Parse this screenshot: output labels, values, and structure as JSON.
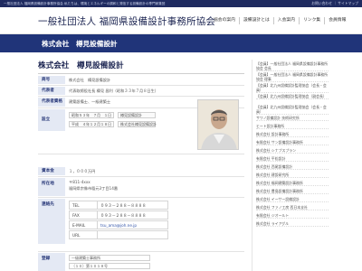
{
  "topbar": {
    "tagline": "一般社団法人 福岡県設備設計事務所協会 私たちは、環境とエネルギーの調和と発信する設備設計の専門家集団",
    "util_links": "お問い合わせ ｜ サイトマップ"
  },
  "header": {
    "site_title": "一般社団法人 福岡県設備設計事務所協会",
    "nav": [
      "協会の案内",
      "設備設計とは",
      "入会案内",
      "リンク集",
      "会員情報"
    ]
  },
  "band": {
    "title": "株式会社　樽見設備設計"
  },
  "main": {
    "company_name": "株式会社　樽見設備設計",
    "rows": {
      "name_label": "商号",
      "name_value": "株式会社　樽見設備設計",
      "rep_label": "代表者",
      "rep_value": "代表取締役社長 樽見 昌利（昭和３３年７月８日生）",
      "qual_label": "代表者資格",
      "qual_value": "建築設備士、一級建築士",
      "est_label": "設立",
      "est_line1_date": "昭和５３年　７月　１日",
      "est_line1_note": "樽見設備設計",
      "est_line2_date": "平成　４年１２月１８日",
      "est_line2_note": "株式会社樽見設備設計",
      "cap_label": "資本金",
      "cap_value": "１，０００万円",
      "addr_label": "所在地",
      "addr_zip": "〒811-4xxx",
      "addr_value": "福岡県宗像市稲元3丁目14番",
      "contact_label": "連絡先",
      "tel_key": "TEL",
      "tel_val": "０９３－２８８－８８８８",
      "fax_key": "FAX",
      "fax_val": "０９３－２８８－８８８８",
      "email_key": "E-MAIL",
      "email_val": "tsu_ama@joh.ne.jp",
      "url_key": "URL",
      "url_val": "",
      "reg_label": "登録",
      "reg_line1": "一級建築士事務所",
      "reg_line2": "（１０）第１０１８号"
    }
  },
  "sidebar": {
    "items": [
      "【会員】一般社団法人 福岡県設備設計事務所協会 会長",
      "【会員】一般社団法人 福岡県設備設計事務所協会 理事",
      "【会員】北九州設備設計監理協会（会長・会員）",
      "【会員】北九州設備設計監理協会（副会長）",
      "【会員】北九州設備設計監理協会（会長・会員）",
      "サワノ設備設計 技術研究所",
      "ヒート設計事務所",
      "株式会社 設計事務所",
      "有限会社 サン設備設計事務所",
      "株式会社 シナプスプラン",
      "有限会社 平松設計",
      "株式会社 西尾設備設計",
      "株式会社 建設研究所",
      "株式会社 福岡建築設計事務所",
      "株式会社 豊島設備設計事務所",
      "株式会社 イーサー設備設計",
      "株式会社 ファノ工房 西日本支社",
      "有限会社 ジオールト",
      "株式会社 ライアグル"
    ]
  },
  "colors": {
    "navy": "#1f2b60",
    "band": "#203479",
    "label_bg": "#e4e9f4"
  }
}
